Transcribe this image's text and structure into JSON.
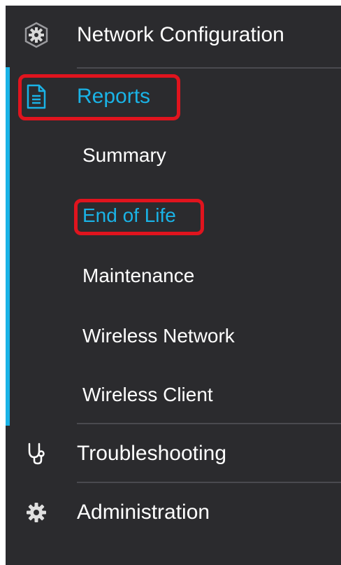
{
  "nav": {
    "network_config": {
      "label": "Network Configuration",
      "icon": "network-gear-icon"
    },
    "reports": {
      "label": "Reports",
      "icon": "document-icon",
      "active_color": "#1ab3e6",
      "submenu": [
        {
          "label": "Summary",
          "selected": false
        },
        {
          "label": "End of Life",
          "selected": true
        },
        {
          "label": "Maintenance",
          "selected": false
        },
        {
          "label": "Wireless Network",
          "selected": false
        },
        {
          "label": "Wireless Client",
          "selected": false
        }
      ]
    },
    "troubleshooting": {
      "label": "Troubleshooting",
      "icon": "stethoscope-icon"
    },
    "administration": {
      "label": "Administration",
      "icon": "gear-icon"
    }
  },
  "colors": {
    "background": "#2b2b2e",
    "accent": "#1ab3e6",
    "highlight": "#e0141e",
    "divider": "#4a4a4f"
  }
}
